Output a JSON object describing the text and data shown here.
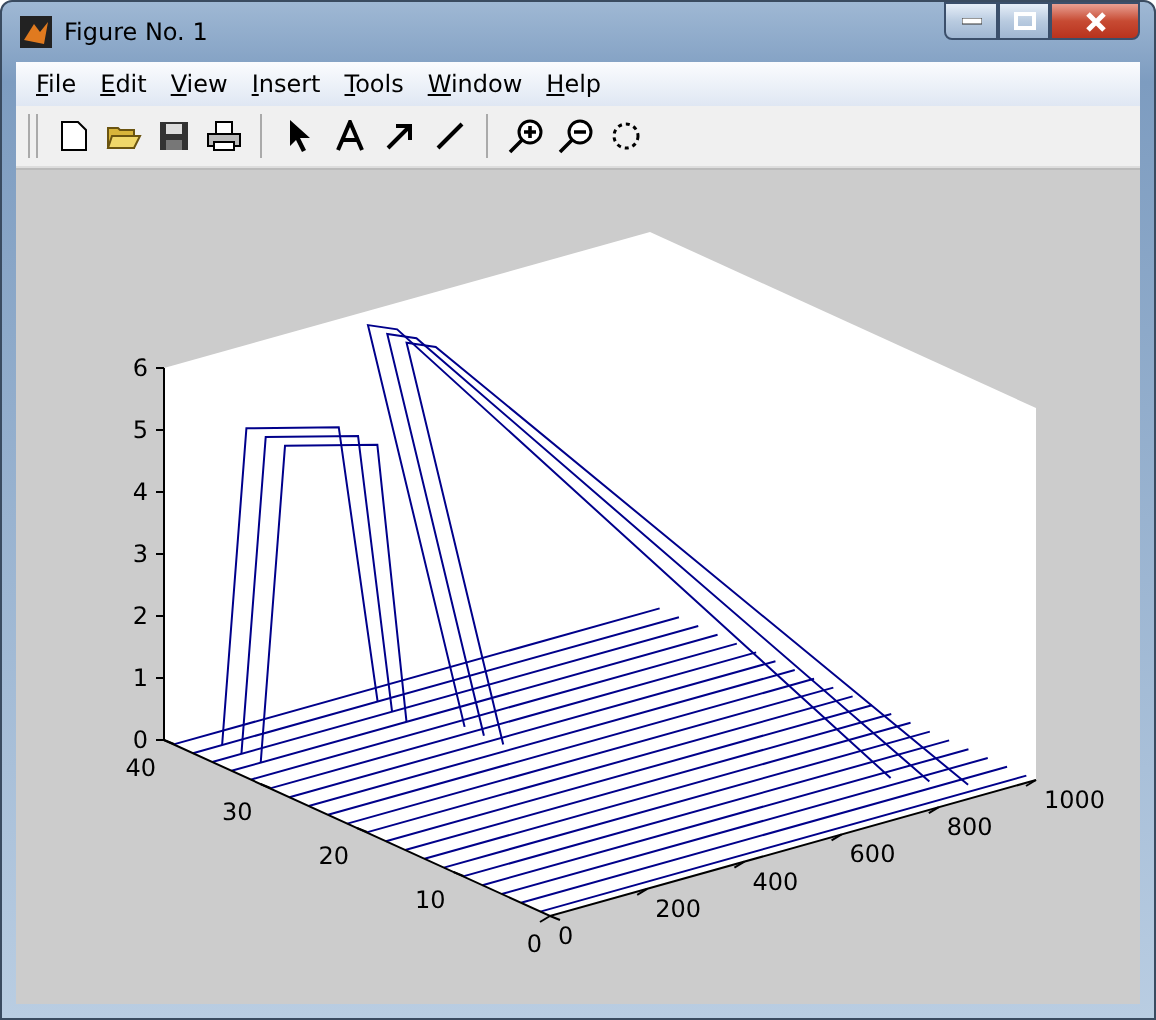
{
  "window": {
    "title": "Figure No. 1"
  },
  "menu": [
    {
      "label": "File"
    },
    {
      "label": "Edit"
    },
    {
      "label": "View"
    },
    {
      "label": "Insert"
    },
    {
      "label": "Tools"
    },
    {
      "label": "Window"
    },
    {
      "label": "Help"
    }
  ],
  "axes": {
    "z_ticks": [
      "6",
      "5",
      "4",
      "3",
      "2",
      "1",
      "0"
    ],
    "y_ticks": [
      "40",
      "30",
      "20",
      "10",
      "0"
    ],
    "x_ticks": [
      "0",
      "200",
      "400",
      "600",
      "800",
      "1000"
    ]
  }
}
